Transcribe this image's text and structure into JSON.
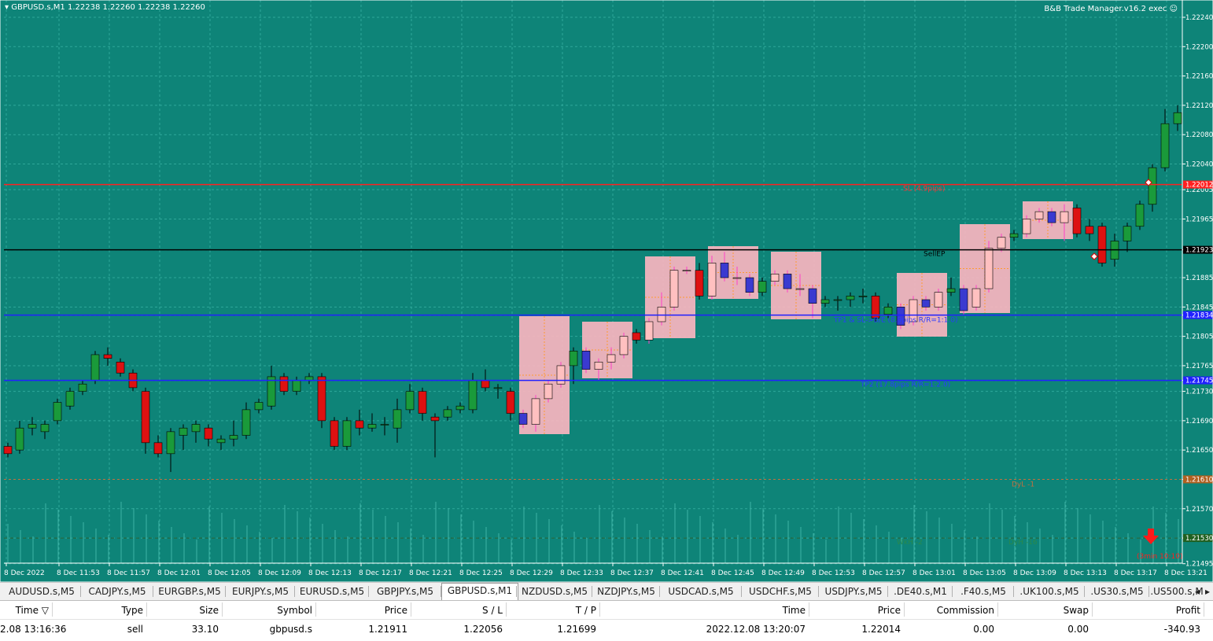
{
  "header": {
    "symbol_info": "GBPUSD.s,M1  1.22238 1.22260 1.22238 1.22260",
    "tool_name": "B&B Trade Manager.v16.2 exec"
  },
  "colors": {
    "background": "#0e8478",
    "bull": "#1a9a3a",
    "bear": "#dd1111",
    "zone": "#ffb6c1",
    "sl_line": "#ff2020",
    "tp_line": "#2020ff",
    "entry_line": "#000000"
  },
  "price_axis": [
    "1.22240",
    "1.22200",
    "1.22160",
    "1.22120",
    "1.22080",
    "1.22040",
    "1.22005",
    "1.21965",
    "1.21923",
    "1.21885",
    "1.21845",
    "1.21834",
    "1.21805",
    "1.21765",
    "1.21745",
    "1.21730",
    "1.21690",
    "1.21650",
    "1.21610",
    "1.21570",
    "1.21530",
    "1.21495"
  ],
  "price_markers": [
    {
      "label": "1.22012",
      "color": "#ff2020"
    },
    {
      "label": "1.21923",
      "color": "#000000"
    },
    {
      "label": "1.21834",
      "color": "#2020ff"
    },
    {
      "label": "1.21745",
      "color": "#2020ff"
    },
    {
      "label": "1.21610",
      "color": "#b06020"
    },
    {
      "label": "1.21530",
      "color": "#206020"
    }
  ],
  "time_axis": [
    "8 Dec 2022",
    "8 Dec 11:53",
    "8 Dec 11:57",
    "8 Dec 12:01",
    "8 Dec 12:05",
    "8 Dec 12:09",
    "8 Dec 12:13",
    "8 Dec 12:17",
    "8 Dec 12:21",
    "8 Dec 12:25",
    "8 Dec 12:29",
    "8 Dec 12:33",
    "8 Dec 12:37",
    "8 Dec 12:41",
    "8 Dec 12:45",
    "8 Dec 12:49",
    "8 Dec 12:53",
    "8 Dec 12:57",
    "8 Dec 13:01",
    "8 Dec 13:05",
    "8 Dec 13:09",
    "8 Dec 13:13",
    "8 Dec 13:17",
    "8 Dec 13:21"
  ],
  "chart_labels": {
    "sl": "SL (4.9pips)",
    "entry": "SellEP",
    "tp1": "TP1 & SL->B/E (8.9pips R/R=1:1.0)",
    "tp2": "TP2 (17.8pips R/R=1:2.0)",
    "dyl": "DyL -1",
    "wkh": "WkH -2",
    "dyh": "DyH -16",
    "timer": "(3min 10:10)"
  },
  "tabs": [
    "AUDUSD.s,M5",
    "CADJPY.s,M5",
    "EURGBP.s,M5",
    "EURJPY.s,M5",
    "EURUSD.s,M5",
    "GBPJPY.s,M5",
    "GBPUSD.s,M1",
    "NZDUSD.s,M5",
    "NZDJPY.s,M5",
    "USDCAD.s,M5",
    "USDCHF.s,M5",
    "USDJPY.s,M5",
    ".DE40.s,M1",
    ".F40.s,M5",
    ".UK100.s,M5",
    ".US30.s,M5",
    ".US500.s,M"
  ],
  "active_tab": "GBPUSD.s,M1",
  "trade_table": {
    "headers": [
      "Time",
      "Type",
      "Size",
      "Symbol",
      "Price",
      "S / L",
      "T / P",
      "Time",
      "Price",
      "Commission",
      "Swap",
      "Profit"
    ],
    "row": [
      "2.08 13:16:36",
      "sell",
      "33.10",
      "gbpusd.s",
      "1.21911",
      "1.22056",
      "1.21699",
      "2022.12.08 13:20:07",
      "1.22014",
      "0.00",
      "0.00",
      "-340.93"
    ]
  }
}
